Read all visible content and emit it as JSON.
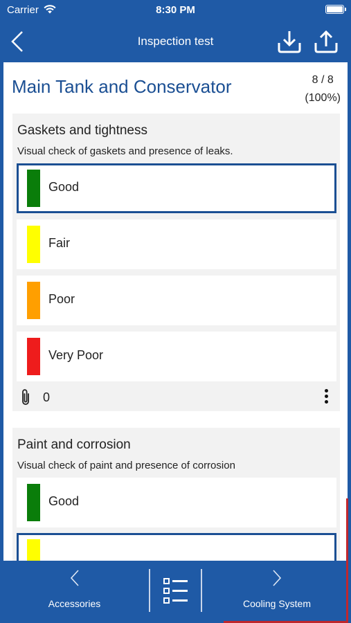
{
  "status_bar": {
    "carrier": "Carrier",
    "time": "8:30 PM"
  },
  "header": {
    "title": "Inspection test",
    "back_icon": "chevron-left-icon",
    "download_icon": "download-icon",
    "upload_icon": "upload-icon"
  },
  "page": {
    "title": "Main Tank and Conservator",
    "progress_count": "8 / 8",
    "progress_percent": "(100%)"
  },
  "sections": [
    {
      "title": "Gaskets and tightness",
      "description": "Visual check of gaskets and presence of leaks.",
      "options": [
        {
          "label": "Good",
          "color": "#0a7d0a",
          "selected": true
        },
        {
          "label": "Fair",
          "color": "#ffff00",
          "selected": false
        },
        {
          "label": "Poor",
          "color": "#ff9f00",
          "selected": false
        },
        {
          "label": "Very Poor",
          "color": "#ee1c1c",
          "selected": false
        }
      ],
      "attachments_count": "0"
    },
    {
      "title": "Paint and corrosion",
      "description": "Visual check of paint and presence of corrosion",
      "options": [
        {
          "label": "Good",
          "color": "#0a7d0a",
          "selected": false
        },
        {
          "label": "",
          "color": "#ffff00",
          "selected": true
        }
      ]
    }
  ],
  "bottom_nav": {
    "prev_label": "Accessories",
    "next_label": "Cooling System",
    "list_icon": "checklist-icon"
  },
  "colors": {
    "primary": "#1f5aa6",
    "title_blue": "#1b4f93",
    "section_bg": "#f2f2f2"
  }
}
